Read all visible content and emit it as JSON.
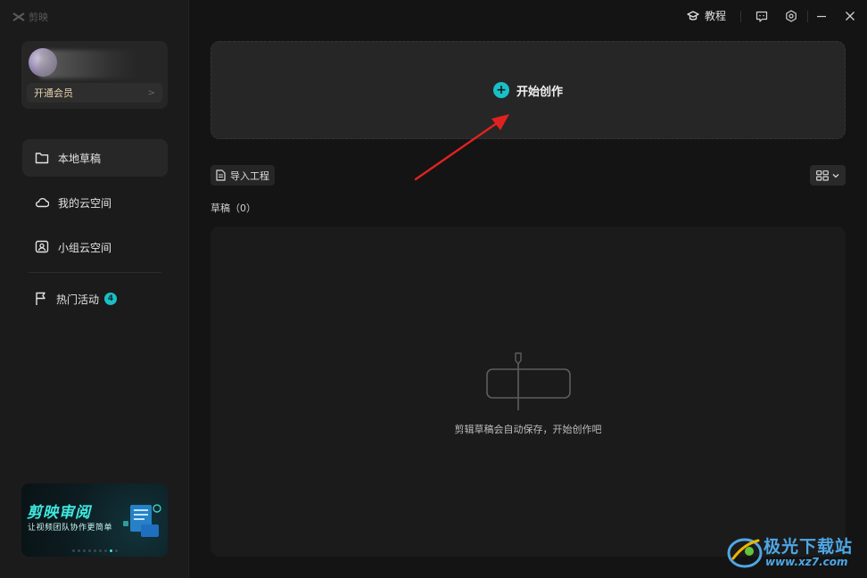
{
  "app": {
    "name": "剪映"
  },
  "user": {
    "vip_label": "开通会员",
    "vip_arrow": ">"
  },
  "sidebar": {
    "items": [
      {
        "label": "本地草稿",
        "icon": "folder-icon"
      },
      {
        "label": "我的云空间",
        "icon": "cloud-icon"
      },
      {
        "label": "小组云空间",
        "icon": "group-space-icon"
      },
      {
        "label": "热门活动",
        "icon": "flag-icon",
        "badge": "4"
      }
    ]
  },
  "banner": {
    "title": "剪映审阅",
    "subtitle": "让视频团队协作更简单"
  },
  "topbar": {
    "tutorial_label": "教程"
  },
  "main": {
    "start_label": "开始创作",
    "import_label": "导入工程",
    "drafts_heading": "草稿（0）",
    "empty_text": "剪辑草稿会自动保存，开始创作吧"
  },
  "watermark": {
    "text": "极光下载站",
    "url": "www.xz7.com"
  },
  "colors": {
    "accent": "#19c0c6",
    "annotation_arrow": "#e0221f",
    "vip_gold": "#e8d3ae",
    "watermark_blue": "#4ea7e6"
  }
}
